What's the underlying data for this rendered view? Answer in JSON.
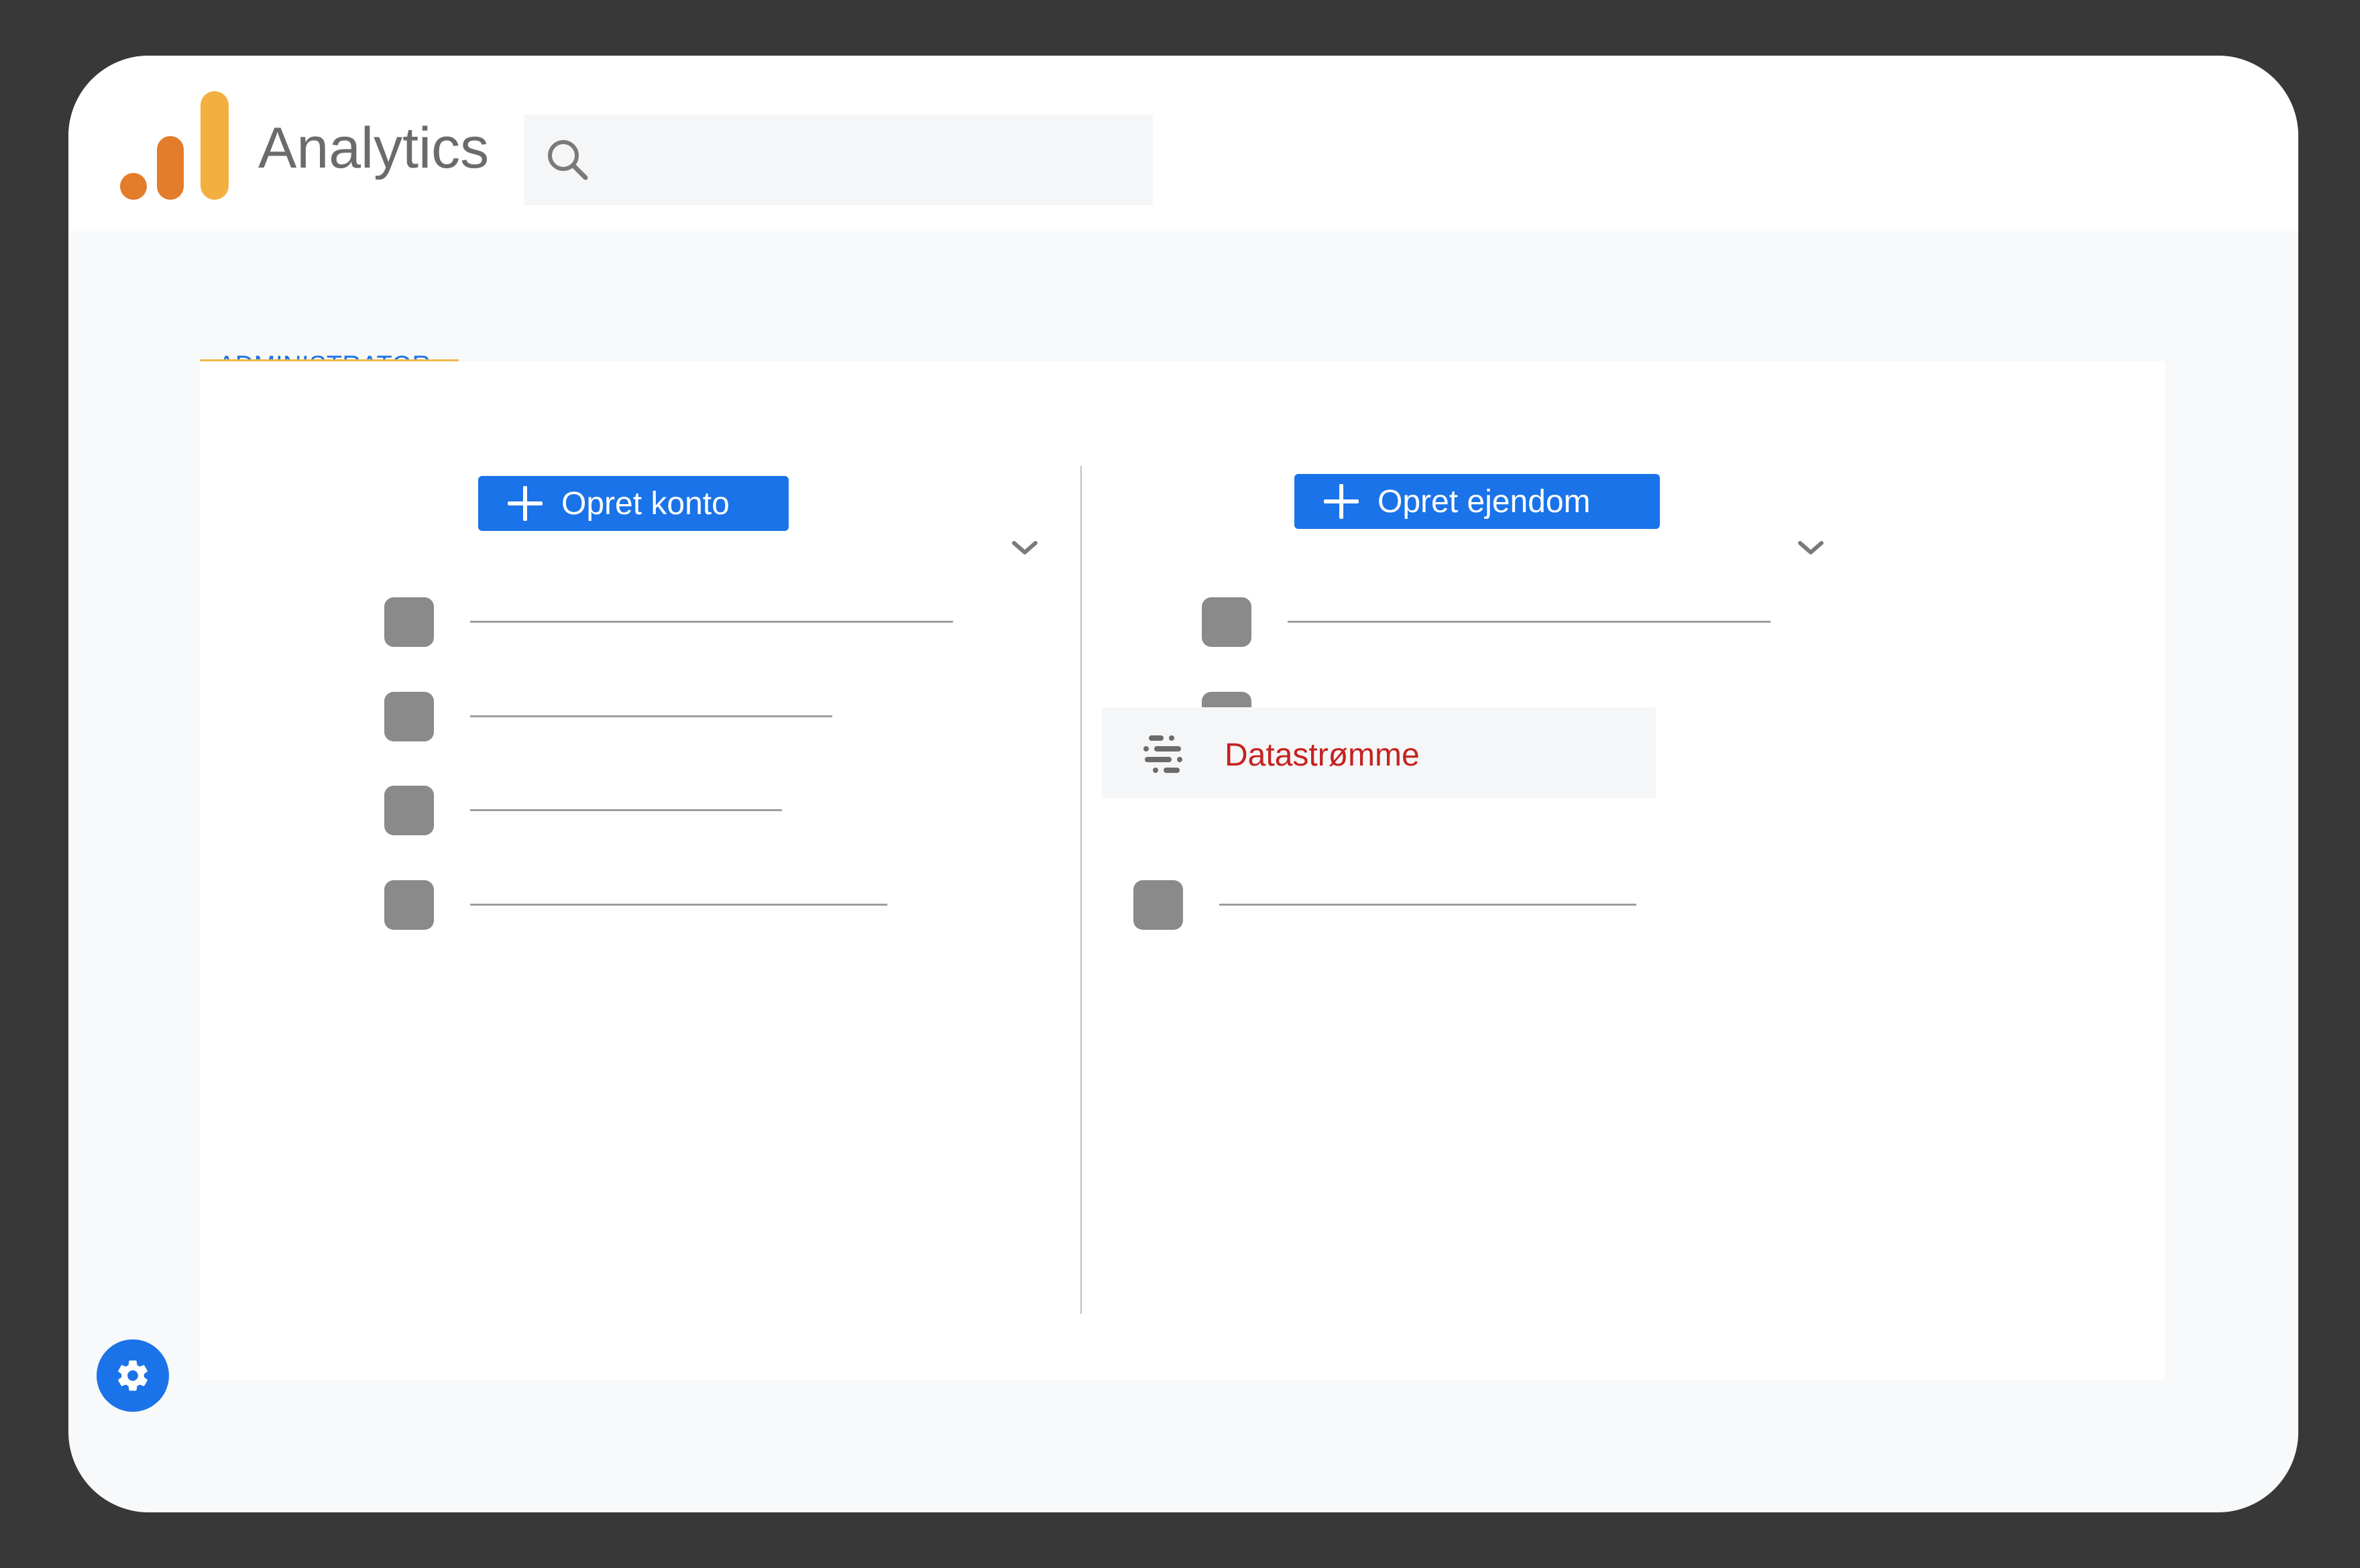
{
  "app": {
    "title": "Analytics"
  },
  "search": {
    "placeholder": ""
  },
  "tabs": [
    {
      "label": "ADMINISTRATOR",
      "active": true
    }
  ],
  "account_column": {
    "create_button": "Opret konto",
    "items": [
      {
        "icon": "placeholder-square",
        "label": ""
      },
      {
        "icon": "placeholder-square",
        "label": ""
      },
      {
        "icon": "placeholder-square",
        "label": ""
      },
      {
        "icon": "placeholder-square",
        "label": ""
      }
    ]
  },
  "property_column": {
    "create_button": "Opret ejendom",
    "items": [
      {
        "icon": "placeholder-square",
        "label": ""
      },
      {
        "icon": "placeholder-square",
        "label": ""
      },
      {
        "icon": "data-streams-icon",
        "label": "Datastrømme",
        "highlighted": true
      },
      {
        "icon": "placeholder-square",
        "label": ""
      }
    ]
  },
  "colors": {
    "accent": "#1a73e8",
    "highlight_text": "#c5221f",
    "tab_underline": "#f0b94b",
    "logo_dark": "#e37c2b",
    "logo_light": "#f4b03f"
  },
  "icons": {
    "logo": "analytics-logo-icon",
    "search": "search-icon",
    "settings": "gear-icon",
    "expand": "chevron-down-icon",
    "add": "plus-icon"
  }
}
